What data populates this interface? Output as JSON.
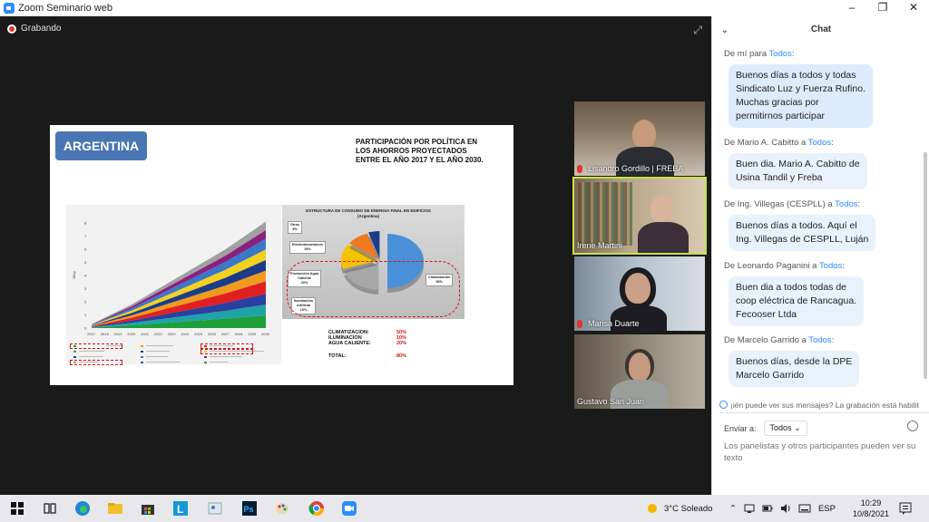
{
  "window": {
    "title": "Zoom Seminario web",
    "minimize": "–",
    "restore": "❐",
    "close": "✕"
  },
  "meeting": {
    "recording_label": "Grabando",
    "expand_icon": "⤢"
  },
  "slide": {
    "country": "ARGENTINA",
    "heading_lines": [
      "PARTICIPACIÓN POR POLÍTICA EN",
      "LOS AHORROS PROYECTADOS",
      "ENTRE EL AÑO 2017 Y EL AÑO 2030."
    ],
    "pie_title_lines": [
      "ESTRUCTURA DE CONSUMO DE ENERGIA FINAL EN EDIFICIOS",
      "(Argentina)"
    ],
    "pie_labels": {
      "otros": [
        "Otros",
        "5%"
      ],
      "electro": [
        "Electrodomésticos",
        "15%"
      ],
      "agua": [
        "Producción Agua",
        "Caliente",
        "20%"
      ],
      "ilum": [
        "Iluminación",
        "Artificial",
        "10%"
      ],
      "clima": [
        "Climatización",
        "50%"
      ]
    },
    "summary": [
      {
        "label": "CLIMATIZACION:",
        "value": "50%"
      },
      {
        "label": "ILUMINACION",
        "value": "10%"
      },
      {
        "label": "AGUA CALIENTE:",
        "value": "20%"
      }
    ],
    "total": {
      "label": "TOTAL:",
      "value": "80%"
    }
  },
  "chart_data": {
    "type": "area",
    "title": "",
    "x": [
      "2017",
      "2018",
      "2019",
      "2020",
      "2021",
      "2022",
      "2023",
      "2024",
      "2025",
      "2026",
      "2027",
      "2028",
      "2029",
      "2030"
    ],
    "yticks": [
      "0",
      "1",
      "2",
      "3",
      "4",
      "5",
      "6",
      "7",
      "8"
    ],
    "ylim": [
      0,
      8
    ],
    "ylabel": "Mtep",
    "series_colors": [
      "#1f9e3a",
      "#1fa3a8",
      "#2b3fa0",
      "#e02020",
      "#f09a20",
      "#1c3c88",
      "#f4d020",
      "#3a78c8",
      "#8a2080",
      "#a0a0a0"
    ],
    "stack_total": [
      0.3,
      0.8,
      1.3,
      1.8,
      2.4,
      3.0,
      3.6,
      4.2,
      4.8,
      5.4,
      6.0,
      6.7,
      7.4,
      8.1
    ],
    "pie": {
      "type": "pie",
      "categories": [
        "Climatización",
        "Producción Agua Caliente",
        "Electrodomésticos",
        "Iluminación Artificial",
        "Otros"
      ],
      "values": [
        50,
        20,
        15,
        10,
        5
      ],
      "colors": [
        "#4a90d8",
        "#a8a8a8",
        "#f4c400",
        "#f07a20",
        "#1c3c88"
      ]
    }
  },
  "participants": [
    {
      "name": "Lisandro Gordillo | FREBA",
      "muted": true
    },
    {
      "name": "Irene Martini",
      "muted": false,
      "active": true
    },
    {
      "name": "Marisa Duarte",
      "muted": true
    },
    {
      "name": "Gustavo San Juan",
      "muted": false
    }
  ],
  "chat": {
    "title": "Chat",
    "messages": [
      {
        "from": "De mí para",
        "to": "Todos",
        "text_lines": [
          "Buenos días a todos y todas",
          "Sindicato Luz y Fuerza Rufino.",
          "Muchas gracias por",
          "permitirnos participar"
        ]
      },
      {
        "from": "De Mario A. Cabitto a",
        "to": "Todos",
        "text_lines": [
          "Buen dia. Mario A. Cabitto de",
          "Usina Tandil y Freba"
        ]
      },
      {
        "from": "De Ing. Villegas (CESPLL) a",
        "to": "Todos",
        "text_lines": [
          "Buenos días a todos. Aquí el",
          "Ing. Villegas de CESPLL, Luján"
        ]
      },
      {
        "from": "De Leonardo Paganini a",
        "to": "Todos",
        "text_lines": [
          "Buen dia a todos todas de",
          "coop eléctrica de Rancagua.",
          "Fecooser Ltda"
        ]
      },
      {
        "from": "De Marcelo Garrido a",
        "to": "Todos",
        "text_lines": [
          "Buenos días, desde la DPE",
          "Marcelo Garrido"
        ]
      }
    ],
    "notice": "¡ién puede ver sus mensajes? La grabación está habilit",
    "send_to_label": "Enviar a:",
    "send_to_value": "Todos",
    "input_placeholder": "Los panelistas y otros participantes pueden ver su texto"
  },
  "taskbar": {
    "weather": "3°C  Soleado",
    "language": "ESP",
    "time": "10:29",
    "date": "10/8/2021"
  }
}
